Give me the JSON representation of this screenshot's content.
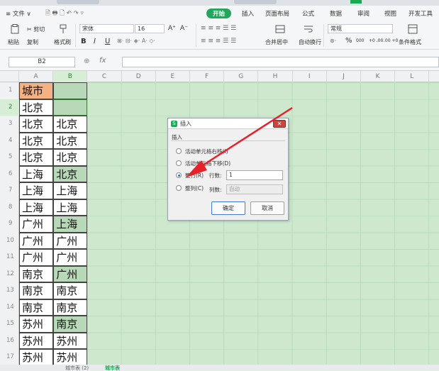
{
  "menubar": {
    "items": [
      "≡ 文件 ∨",
      "开始",
      "插入",
      "页面布局",
      "公式",
      "数据",
      "审阅",
      "视图",
      "开发工具"
    ]
  },
  "ribbon": {
    "cut": "✂ 剪切",
    "copy": "复制",
    "paste": "粘贴",
    "format_painter": "格式刷",
    "font_name": "宋体",
    "font_size": "16",
    "font_grow": "A⁺",
    "font_shrink": "A⁻",
    "bold": "B",
    "italic": "I",
    "underline": "U",
    "merge_center": "合并居中",
    "wrap_text": "自动换行",
    "number_format": "常规",
    "percent": "%",
    "thousand": "000",
    "inc_decimal": "+0 .00",
    "dec_decimal": ".00 +0",
    "cond_format": "条件格式"
  },
  "formula_bar": {
    "cell_ref": "B2",
    "fx": "fx",
    "value": ""
  },
  "columns": [
    "A",
    "B",
    "C",
    "D",
    "E",
    "F",
    "G",
    "H",
    "I",
    "J",
    "K",
    "L"
  ],
  "rows": [
    "1",
    "2",
    "3",
    "4",
    "5",
    "6",
    "7",
    "8",
    "9",
    "10",
    "11",
    "12",
    "13",
    "14",
    "15",
    "16",
    "17"
  ],
  "cells": {
    "colA": [
      "城市",
      "北京",
      "北京",
      "北京",
      "北京",
      "上海",
      "上海",
      "上海",
      "广州",
      "广州",
      "广州",
      "南京",
      "南京",
      "南京",
      "苏州",
      "苏州",
      "苏州"
    ],
    "colB": [
      "",
      "",
      "北京",
      "北京",
      "北京",
      "北京",
      "上海",
      "上海",
      "上海",
      "广州",
      "广州",
      "广州",
      "南京",
      "南京",
      "南京",
      "苏州",
      "苏州"
    ]
  },
  "sheet_tabs": [
    "城市表 (2)",
    "城市表"
  ],
  "dialog": {
    "title": "插入",
    "group": "插入",
    "options": [
      "活动单元格右移(I)",
      "活动单元格下移(D)",
      "整行(R)",
      "整列(C)"
    ],
    "selected_index": 2,
    "row_count_label": "行数:",
    "row_count_value": "1",
    "col_count_label": "列数:",
    "col_count_value": "自动",
    "ok": "确定",
    "cancel": "取消",
    "close": "✕"
  },
  "colors": {
    "accent": "#21a65b",
    "grid": "#cde8cd",
    "header_cell": "#f4b183",
    "arrow": "#e8202a"
  }
}
